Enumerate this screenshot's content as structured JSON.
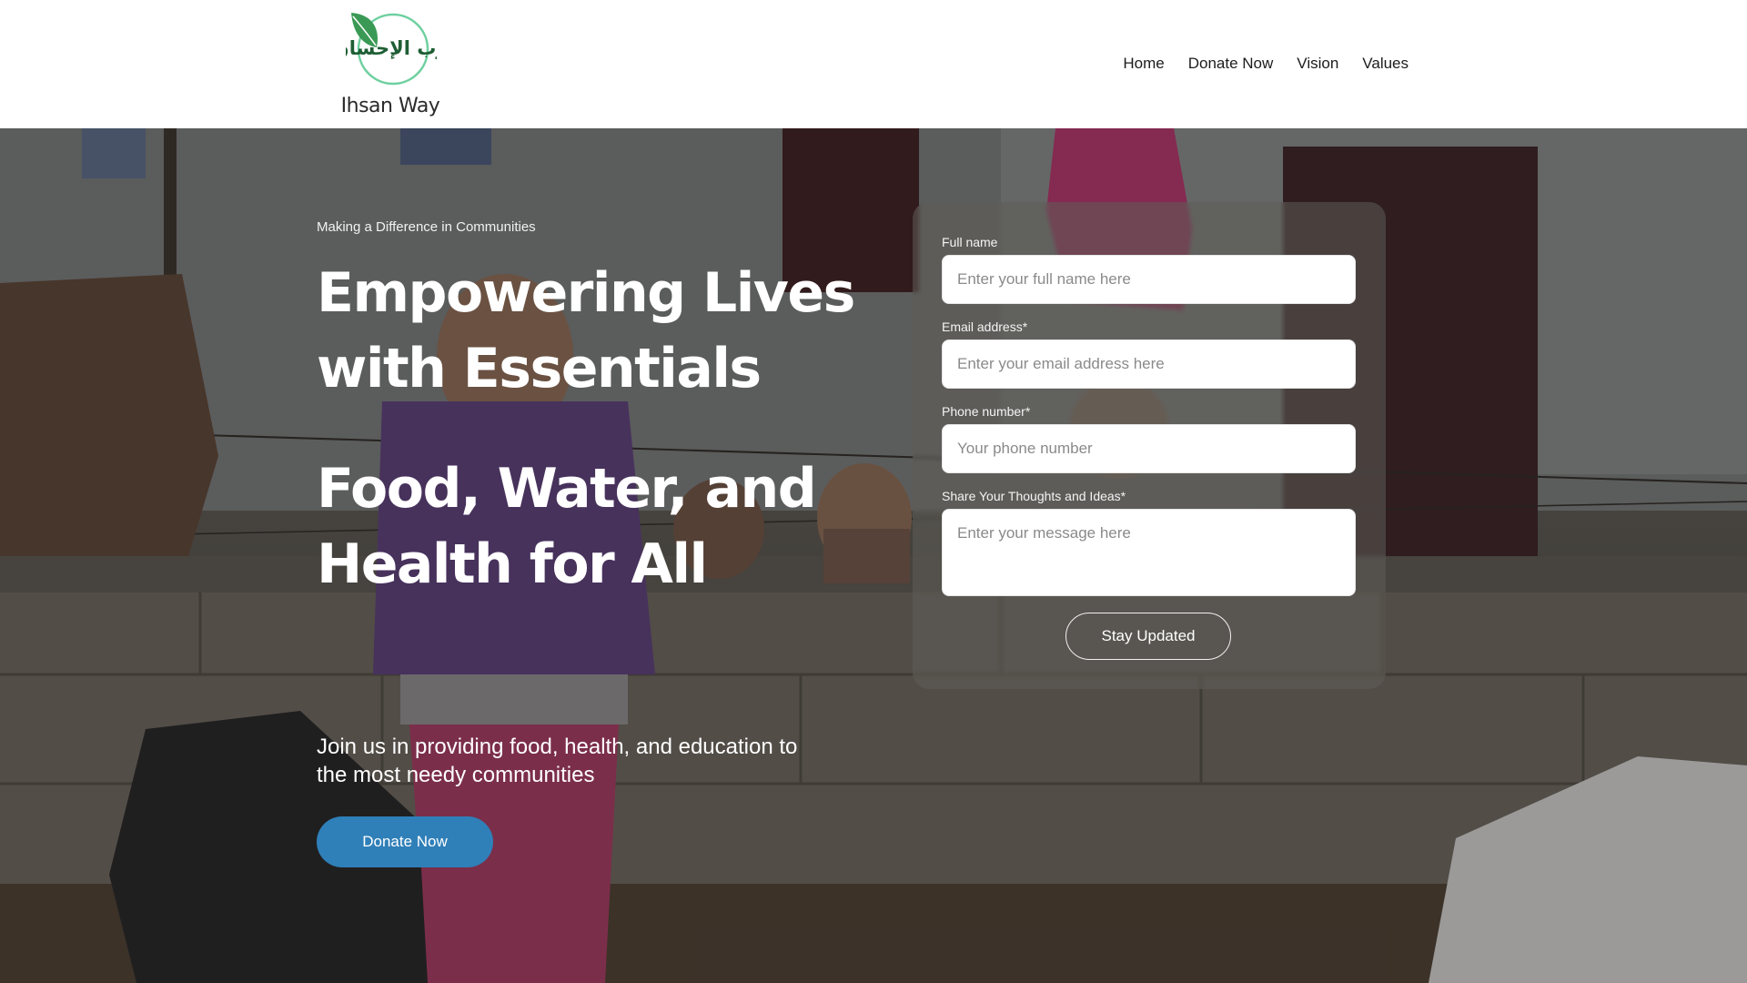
{
  "header": {
    "logo": {
      "arabic": "درب الإحسان",
      "name": "Ihsan Way"
    },
    "nav": [
      {
        "label": "Home"
      },
      {
        "label": "Donate Now"
      },
      {
        "label": "Vision"
      },
      {
        "label": "Values"
      }
    ]
  },
  "hero": {
    "eyebrow": "Making a Difference in Communities",
    "title_line1": "Empowering Lives",
    "title_line2": "with Essentials",
    "title2_line1": "Food, Water, and",
    "title2_line2": "Health for All",
    "subtitle": "Join us in providing food, health, and education to the most needy communities",
    "donate_button": "Donate Now"
  },
  "form": {
    "full_name": {
      "label": "Full name",
      "placeholder": "Enter your full name here",
      "value": ""
    },
    "email": {
      "label": "Email address*",
      "placeholder": "Enter your email address here",
      "value": ""
    },
    "phone": {
      "label": "Phone number*",
      "placeholder": "Your phone number",
      "value": ""
    },
    "message": {
      "label": "Share Your Thoughts and Ideas*",
      "placeholder": "Enter your message here",
      "value": ""
    },
    "submit": "Stay Updated"
  },
  "colors": {
    "accent": "#2f7fb8",
    "logo_green": "#3a9a55",
    "logo_ring": "#6fd0a0",
    "logo_text_green": "#1e5e34"
  },
  "icons": {
    "logo_leaf": "leaf-icon"
  }
}
